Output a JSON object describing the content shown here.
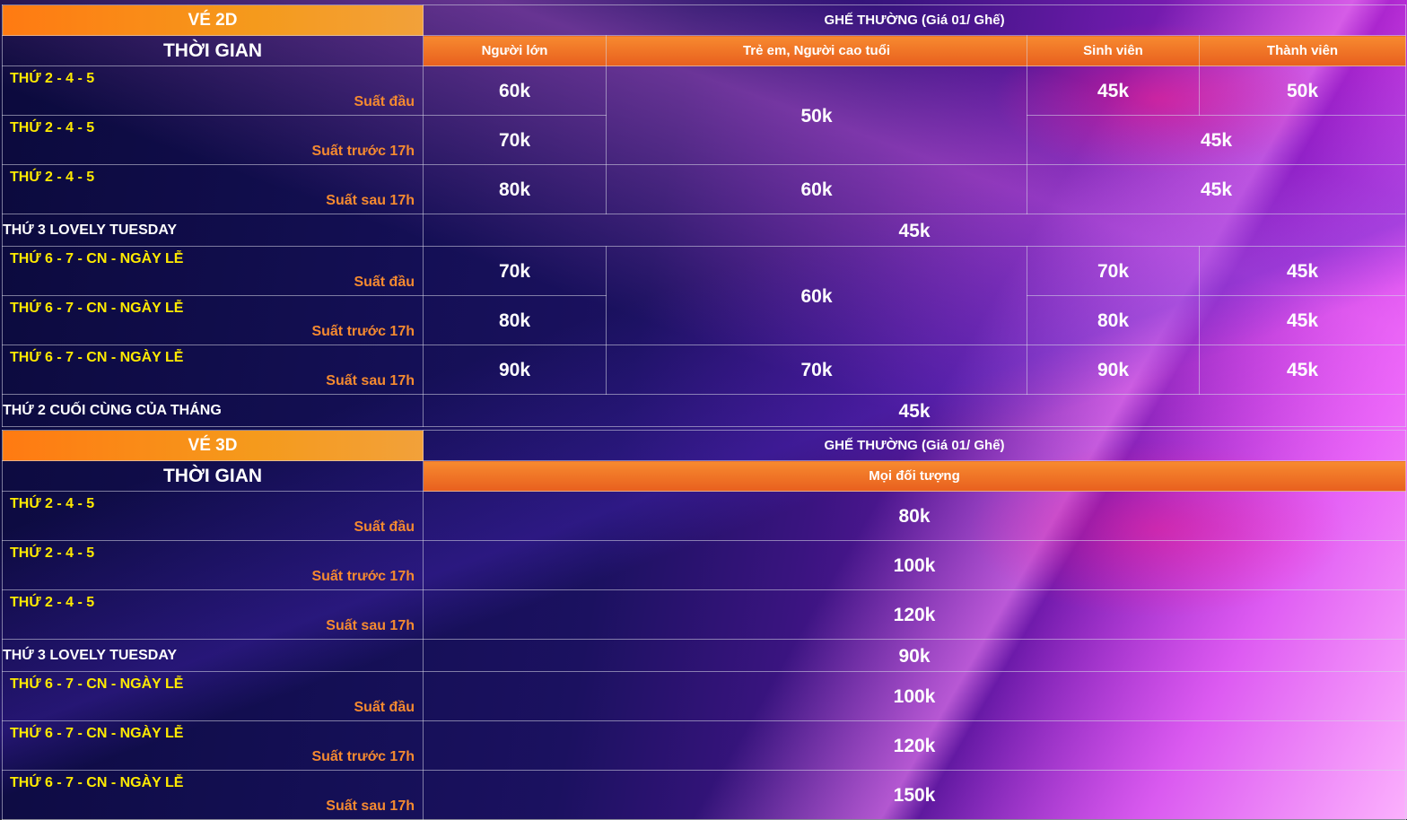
{
  "t2d": {
    "title": "VÉ 2D",
    "seat_type": "GHẾ THƯỜNG (Giá 01/ Ghế)",
    "time_header": "THỜI GIAN",
    "categories": [
      "Người lớn",
      "Trẻ em, Người cao tuổi",
      "Sinh viên",
      "Thành viên"
    ],
    "rows": [
      {
        "day": "THỨ 2 - 4 - 5",
        "show": "Suất đầu",
        "adult": "60k",
        "child_senior": "50k",
        "student": "45k",
        "member": "50k"
      },
      {
        "day": "THỨ 2 - 4 - 5",
        "show": "Suất trước 17h",
        "adult": "70k",
        "student_member": "45k"
      },
      {
        "day": "THỨ 2 - 4 - 5",
        "show": "Suất sau 17h",
        "adult": "80k",
        "child_senior": "60k",
        "student_member": "45k"
      },
      {
        "day": "THỨ 3 LOVELY TUESDAY",
        "all": "45k"
      },
      {
        "day": "THỨ 6 - 7 - CN - NGÀY LỄ",
        "show": "Suất đầu",
        "adult": "70k",
        "child_senior": "60k",
        "student": "70k",
        "member": "45k"
      },
      {
        "day": "THỨ 6 - 7 - CN - NGÀY LỄ",
        "show": "Suất trước 17h",
        "adult": "80k",
        "student": "80k",
        "member": "45k"
      },
      {
        "day": "THỨ 6 - 7 - CN - NGÀY LỄ",
        "show": "Suất sau 17h",
        "adult": "90k",
        "child_senior": "70k",
        "student": "90k",
        "member": "45k"
      },
      {
        "day": "THỨ 2 CUỐI CÙNG CỦA THÁNG",
        "all": "45k"
      }
    ]
  },
  "t3d": {
    "title": "VÉ 3D",
    "seat_type": "GHẾ THƯỜNG (Giá 01/ Ghế)",
    "time_header": "THỜI GIAN",
    "category": "Mọi đối tượng",
    "rows": [
      {
        "day": "THỨ 2 - 4 - 5",
        "show": "Suất đầu",
        "price": "80k"
      },
      {
        "day": "THỨ 2 - 4 - 5",
        "show": "Suất trước 17h",
        "price": "100k"
      },
      {
        "day": "THỨ 2 - 4 - 5",
        "show": "Suất sau 17h",
        "price": "120k"
      },
      {
        "day": "THỨ 3 LOVELY TUESDAY",
        "price": "90k"
      },
      {
        "day": "THỨ 6 - 7 - CN - NGÀY LỄ",
        "show": "Suất đầu",
        "price": "100k"
      },
      {
        "day": "THỨ 6 - 7 - CN - NGÀY LỄ",
        "show": "Suất trước 17h",
        "price": "120k"
      },
      {
        "day": "THỨ 6 - 7 - CN - NGÀY LỄ",
        "show": "Suất sau 17h",
        "price": "150k"
      }
    ]
  },
  "colors": {
    "orange": "#f27a1f",
    "day_yellow": "#ffea00",
    "show_orange": "#f58a30",
    "bg_navy": "#0b0a3c",
    "bg_magenta": "#d43be6"
  }
}
